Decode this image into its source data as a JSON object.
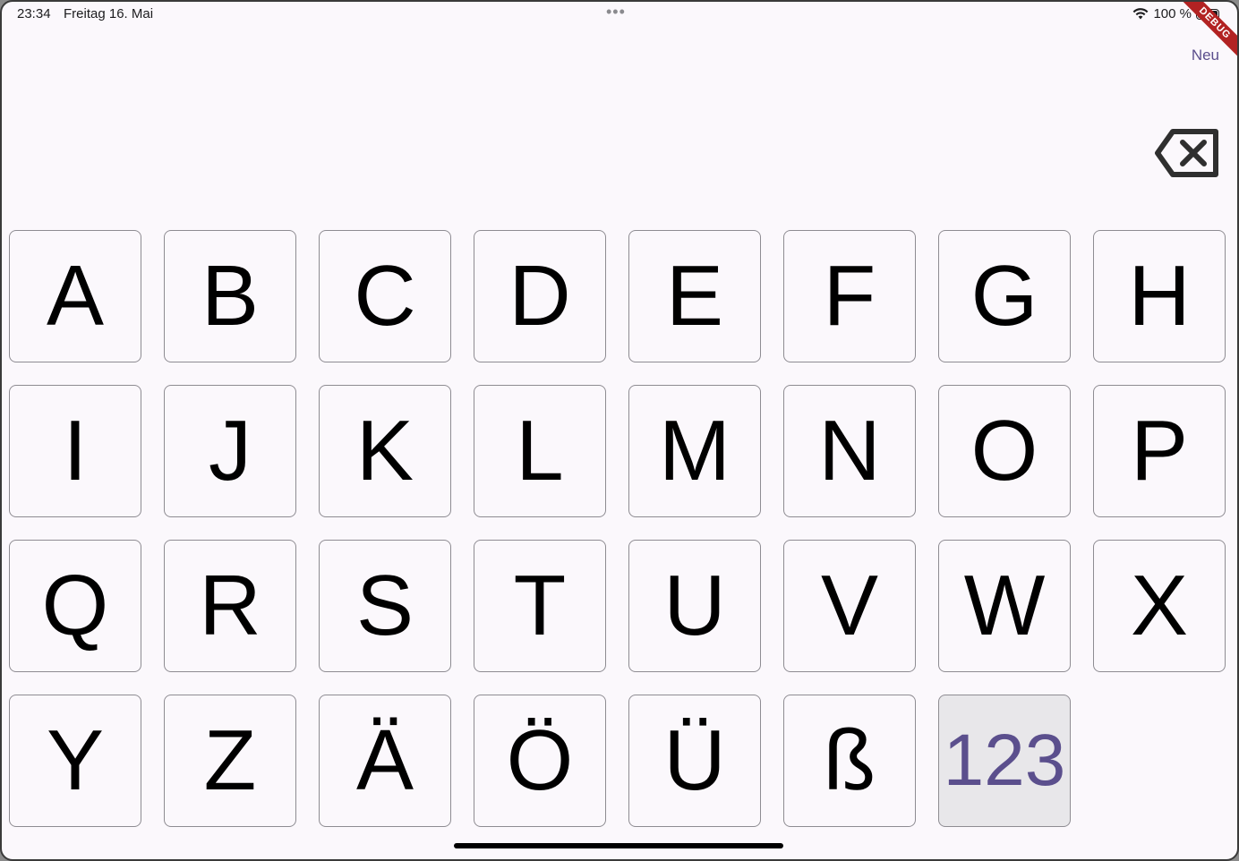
{
  "status_bar": {
    "time": "23:34",
    "date": "Freitag 16. Mai",
    "dots": "•••",
    "battery_text": "100 %",
    "wifi_icon": "wifi-icon",
    "battery_icon": "battery-icon"
  },
  "debug_banner": "DEBUG",
  "toolbar": {
    "new_label": "Neu",
    "backspace_icon": "backspace-icon"
  },
  "keyboard": {
    "rows": [
      [
        "A",
        "B",
        "C",
        "D",
        "E",
        "F",
        "G",
        "H"
      ],
      [
        "I",
        "J",
        "K",
        "L",
        "M",
        "N",
        "O",
        "P"
      ],
      [
        "Q",
        "R",
        "S",
        "T",
        "U",
        "V",
        "W",
        "X"
      ],
      [
        "Y",
        "Z",
        "Ä",
        "Ö",
        "Ü",
        "ß",
        "123"
      ]
    ]
  }
}
